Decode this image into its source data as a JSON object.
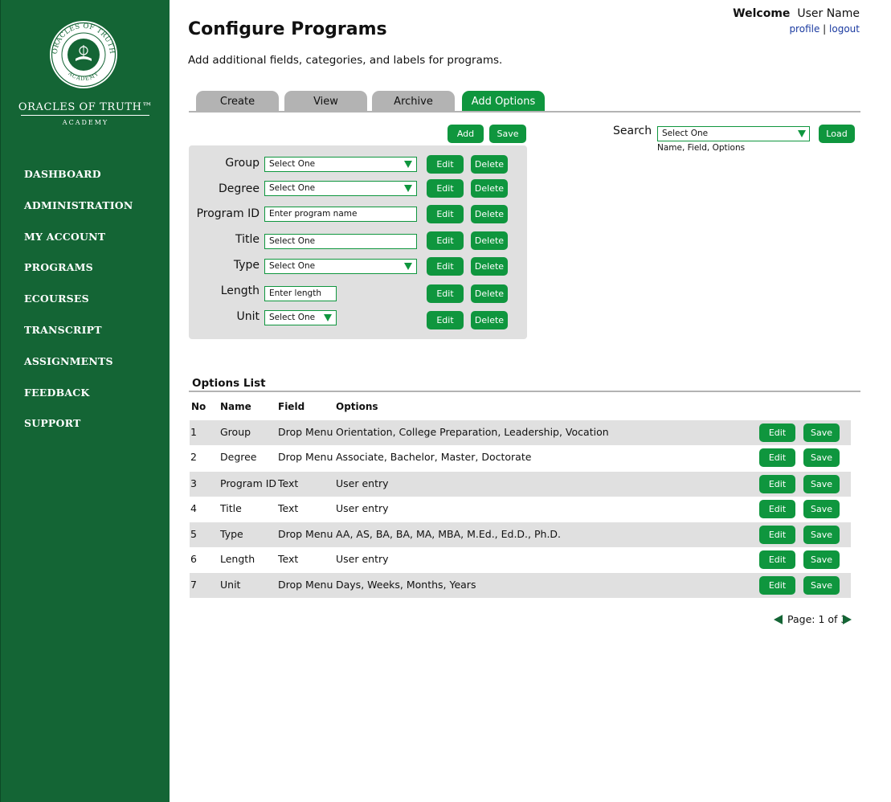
{
  "brand": {
    "seal_top_text": "ORACLES OF TRUTH",
    "seal_bottom_text": "ACADEMY",
    "name": "ORACLES OF TRUTH™",
    "sub": "ACADEMY"
  },
  "nav": [
    "DASHBOARD",
    "ADMINISTRATION",
    "MY ACCOUNT",
    "PROGRAMS",
    "ECOURSES",
    "TRANSCRIPT",
    "ASSIGNMENTS",
    "FEEDBACK",
    "SUPPORT"
  ],
  "header": {
    "title": "Configure Programs",
    "description": "Add additional fields, categories, and labels for programs.",
    "welcome_label": "Welcome",
    "user_name": "User Name",
    "profile_link": "profile",
    "separator": "|",
    "logout_link": "logout"
  },
  "tabs": [
    {
      "label": "Create",
      "active": false
    },
    {
      "label": "View",
      "active": false
    },
    {
      "label": "Archive",
      "active": false
    },
    {
      "label": "Add Options",
      "active": true
    }
  ],
  "toolbar": {
    "add_label": "Add",
    "save_label": "Save"
  },
  "search": {
    "label": "Search",
    "select_value": "Select One",
    "hint": "Name, Field, Options",
    "load_label": "Load"
  },
  "form": {
    "edit_label": "Edit",
    "delete_label": "Delete",
    "fields": [
      {
        "label": "Group",
        "value": "Select One",
        "dropdown": true
      },
      {
        "label": "Degree",
        "value": "Select One",
        "dropdown": true
      },
      {
        "label": "Program ID",
        "value": "Enter program name",
        "dropdown": false
      },
      {
        "label": "Title",
        "value": "Select One",
        "dropdown": false
      },
      {
        "label": "Type",
        "value": "Select One",
        "dropdown": true
      },
      {
        "label": "Length",
        "value": "Enter length",
        "dropdown": false
      },
      {
        "label": "Unit",
        "value": "Select One",
        "dropdown": true
      }
    ]
  },
  "options_list": {
    "title": "Options List",
    "columns": [
      "No",
      "Name",
      "Field",
      "Options"
    ],
    "edit_label": "Edit",
    "save_label": "Save",
    "rows": [
      {
        "no": "1",
        "name": "Group",
        "field": "Drop Menu",
        "options": "Orientation, College Preparation, Leadership, Vocation"
      },
      {
        "no": "2",
        "name": "Degree",
        "field": "Drop Menu",
        "options": "Associate, Bachelor, Master, Doctorate"
      },
      {
        "no": "3",
        "name": "Program ID",
        "field": "Text",
        "options": "User entry"
      },
      {
        "no": "4",
        "name": "Title",
        "field": "Text",
        "options": "User entry"
      },
      {
        "no": "5",
        "name": "Type",
        "field": "Drop Menu",
        "options": "AA, AS, BA, BA, MA, MBA, M.Ed., Ed.D., Ph.D."
      },
      {
        "no": "6",
        "name": "Length",
        "field": "Text",
        "options": "User entry"
      },
      {
        "no": "7",
        "name": "Unit",
        "field": "Drop Menu",
        "options": "Days, Weeks, Months, Years"
      }
    ]
  },
  "pager": {
    "text": "Page: 1 of 3"
  },
  "colors": {
    "brand_green": "#146535",
    "accent_green": "#0f963e",
    "tab_gray": "#b3b3b3",
    "panel_gray": "#e0e0e0"
  }
}
